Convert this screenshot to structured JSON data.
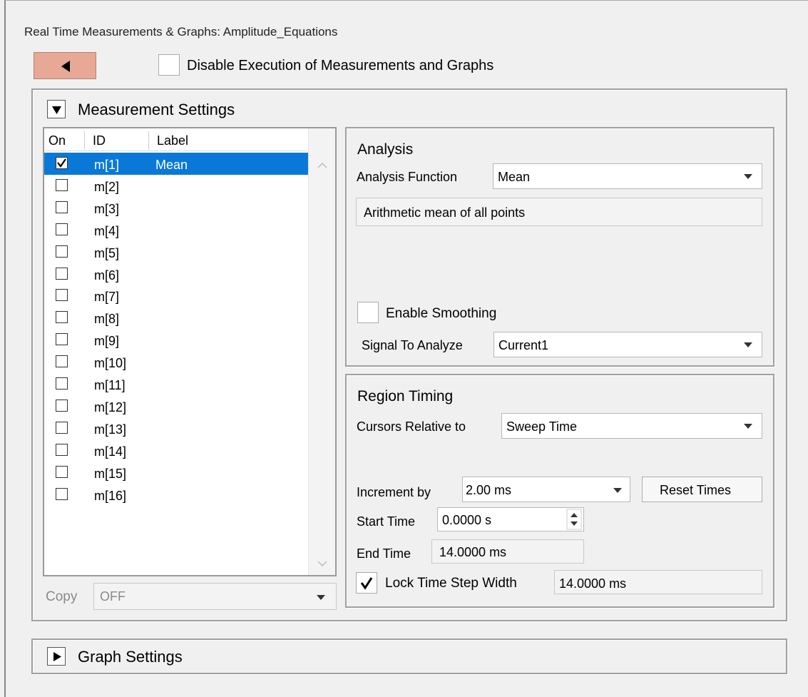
{
  "window": {
    "title": "Real Time Measurements & Graphs: Amplitude_Equations"
  },
  "top": {
    "disable_label": "Disable Execution of Measurements and Graphs",
    "disable_checked": false
  },
  "measurement": {
    "section_label": "Measurement Settings",
    "columns": {
      "on": "On",
      "id": "ID",
      "label": "Label"
    },
    "rows": [
      {
        "id": "m[1]",
        "label": "Mean",
        "on": true,
        "selected": true
      },
      {
        "id": "m[2]",
        "label": "",
        "on": false
      },
      {
        "id": "m[3]",
        "label": "",
        "on": false
      },
      {
        "id": "m[4]",
        "label": "",
        "on": false
      },
      {
        "id": "m[5]",
        "label": "",
        "on": false
      },
      {
        "id": "m[6]",
        "label": "",
        "on": false
      },
      {
        "id": "m[7]",
        "label": "",
        "on": false
      },
      {
        "id": "m[8]",
        "label": "",
        "on": false
      },
      {
        "id": "m[9]",
        "label": "",
        "on": false
      },
      {
        "id": "m[10]",
        "label": "",
        "on": false
      },
      {
        "id": "m[11]",
        "label": "",
        "on": false
      },
      {
        "id": "m[12]",
        "label": "",
        "on": false
      },
      {
        "id": "m[13]",
        "label": "",
        "on": false
      },
      {
        "id": "m[14]",
        "label": "",
        "on": false
      },
      {
        "id": "m[15]",
        "label": "",
        "on": false
      },
      {
        "id": "m[16]",
        "label": "",
        "on": false
      }
    ],
    "copy_label": "Copy",
    "copy_value": "OFF"
  },
  "analysis": {
    "title": "Analysis",
    "function_label": "Analysis Function",
    "function_value": "Mean",
    "description": "Arithmetic mean of all points",
    "smoothing_label": "Enable Smoothing",
    "smoothing_checked": false,
    "signal_label": "Signal To Analyze",
    "signal_value": "Current1"
  },
  "timing": {
    "title": "Region Timing",
    "cursors_label": "Cursors Relative to",
    "cursors_value": "Sweep Time",
    "increment_label": "Increment by",
    "increment_value": "2.00 ms",
    "reset_label": "Reset Times",
    "start_label": "Start Time",
    "start_value": "0.0000 s",
    "end_label": "End Time",
    "end_value": "14.0000 ms",
    "lock_label": "Lock Time Step Width",
    "lock_checked": true,
    "lock_value": "14.0000 ms"
  },
  "graph": {
    "section_label": "Graph Settings"
  },
  "colors": {
    "back_button": "#e8a896",
    "selection": "#0a78d7"
  }
}
